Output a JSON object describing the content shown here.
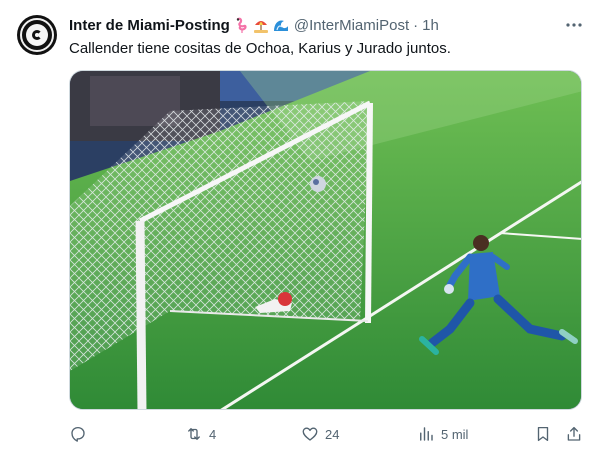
{
  "tweet": {
    "author": {
      "display_name": "Inter de Miami-Posting",
      "emojis": [
        "flamingo-emoji",
        "beach-umbrella-emoji",
        "wave-emoji"
      ],
      "handle": "@InterMiamiPost",
      "separator": "·",
      "time": "1h",
      "avatar": "inter-miami-crest"
    },
    "text": "Callender tiene cositas de Ochoa, Karius y Jurado juntos.",
    "media": {
      "kind": "photo",
      "description_icon": "soccer-goal-photo"
    },
    "actions": {
      "reply": {
        "icon": "reply-icon",
        "count": ""
      },
      "retweet": {
        "icon": "retweet-icon",
        "count": "4"
      },
      "like": {
        "icon": "heart-icon",
        "count": "24"
      },
      "views": {
        "icon": "views-icon",
        "count": "5 mil"
      },
      "bookmark": {
        "icon": "bookmark-icon"
      },
      "share": {
        "icon": "share-icon"
      }
    },
    "colors": {
      "text_primary": "#0f1419",
      "text_secondary": "#536471",
      "border": "#cfd9de",
      "pitch_green": "#3a9a3e",
      "keeper_kit": "#2f6fc7"
    }
  }
}
